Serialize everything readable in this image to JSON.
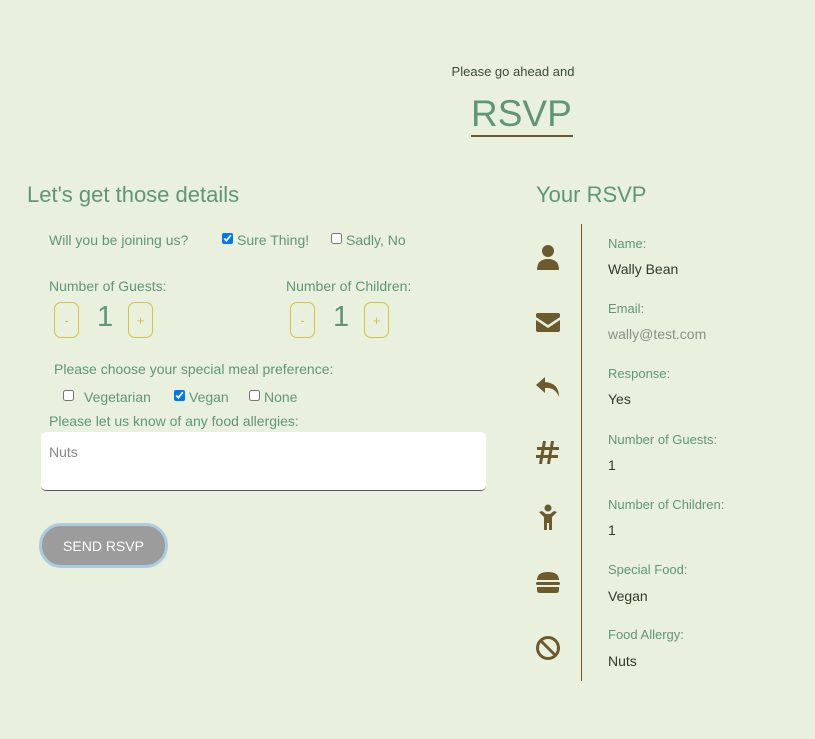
{
  "intro": "Please go ahead and",
  "title": "RSVP",
  "form": {
    "heading": "Let's get those details",
    "join_question": "Will you be joining us?",
    "yes_label": "Sure Thing!",
    "no_label": "Sadly, No",
    "yes_checked": true,
    "no_checked": false,
    "guests_label": "Number of Guests:",
    "children_label": "Number of Children:",
    "guests_value": "1",
    "children_value": "1",
    "minus": "-",
    "plus": "+",
    "meal_question": "Please choose your special meal preference:",
    "meal_options": [
      {
        "label": "Vegetarian",
        "checked": false
      },
      {
        "label": "Vegan",
        "checked": true
      },
      {
        "label": "None",
        "checked": false
      }
    ],
    "allergy_question": "Please let us know of any food allergies:",
    "allergy_value": "Nuts",
    "send_label": "SEND RSVP"
  },
  "summary": {
    "heading": "Your RSVP",
    "items": [
      {
        "label": "Name:",
        "value": "Wally Bean",
        "icon": "user-icon"
      },
      {
        "label": "Email:",
        "value": "wally@test.com",
        "icon": "envelope-icon"
      },
      {
        "label": "Response:",
        "value": "Yes",
        "icon": "reply-icon"
      },
      {
        "label": "Number of Guests:",
        "value": "1",
        "icon": "hashtag-icon"
      },
      {
        "label": "Number of Children:",
        "value": "1",
        "icon": "child-icon"
      },
      {
        "label": "Special Food:",
        "value": "Vegan",
        "icon": "burger-icon"
      },
      {
        "label": "Food Allergy:",
        "value": "Nuts",
        "icon": "ban-icon"
      }
    ]
  },
  "colors": {
    "background": "#e9f0dd",
    "accent_green": "#5f9676",
    "brown": "#6b5a2e",
    "yellow": "#d6c240"
  }
}
